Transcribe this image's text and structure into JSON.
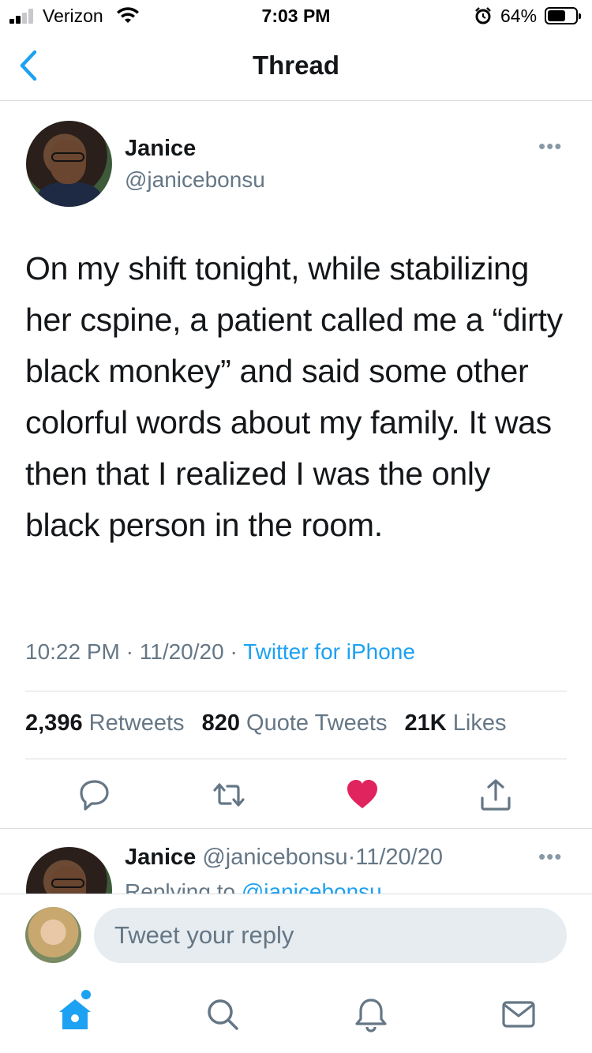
{
  "status_bar": {
    "carrier": "Verizon",
    "time": "7:03 PM",
    "battery_percent": "64%",
    "battery_level": 0.64,
    "signal_bars": 2
  },
  "header": {
    "title": "Thread",
    "back_icon": "chevron-left-icon"
  },
  "tweet": {
    "author_name": "Janice",
    "author_handle": "@janicebonsu",
    "text": "On my shift tonight, while stabilizing her cspine, a patient called me a “dirty black monkey” and said some other colorful words about my family. It was then that I realized I was the only black person in the room.",
    "time": "10:22 PM",
    "date": "11/20/20",
    "separator": "·",
    "source": "Twitter for iPhone",
    "more_label": "•••",
    "stats": {
      "retweets_count": "2,396",
      "retweets_label": "Retweets",
      "quotes_count": "820",
      "quotes_label": "Quote Tweets",
      "likes_count": "21K",
      "likes_label": "Likes"
    },
    "actions": [
      "reply-icon",
      "retweet-icon",
      "heart-filled-icon",
      "share-icon"
    ],
    "liked": true
  },
  "reply": {
    "author_name": "Janice",
    "author_handle": "@janicebonsu",
    "separator": "·",
    "date": "11/20/20",
    "replying_prefix": "Replying to",
    "replying_to": "@janicebonsu",
    "more_label": "•••"
  },
  "compose": {
    "placeholder": "Tweet your reply"
  },
  "tabbar": {
    "tabs": [
      "home-icon",
      "search-icon",
      "bell-icon",
      "mail-icon"
    ],
    "active": "home-icon"
  },
  "colors": {
    "accent": "#1da1f2",
    "like": "#e0245e",
    "secondary_text": "#657786",
    "divider": "#d8dde1"
  }
}
